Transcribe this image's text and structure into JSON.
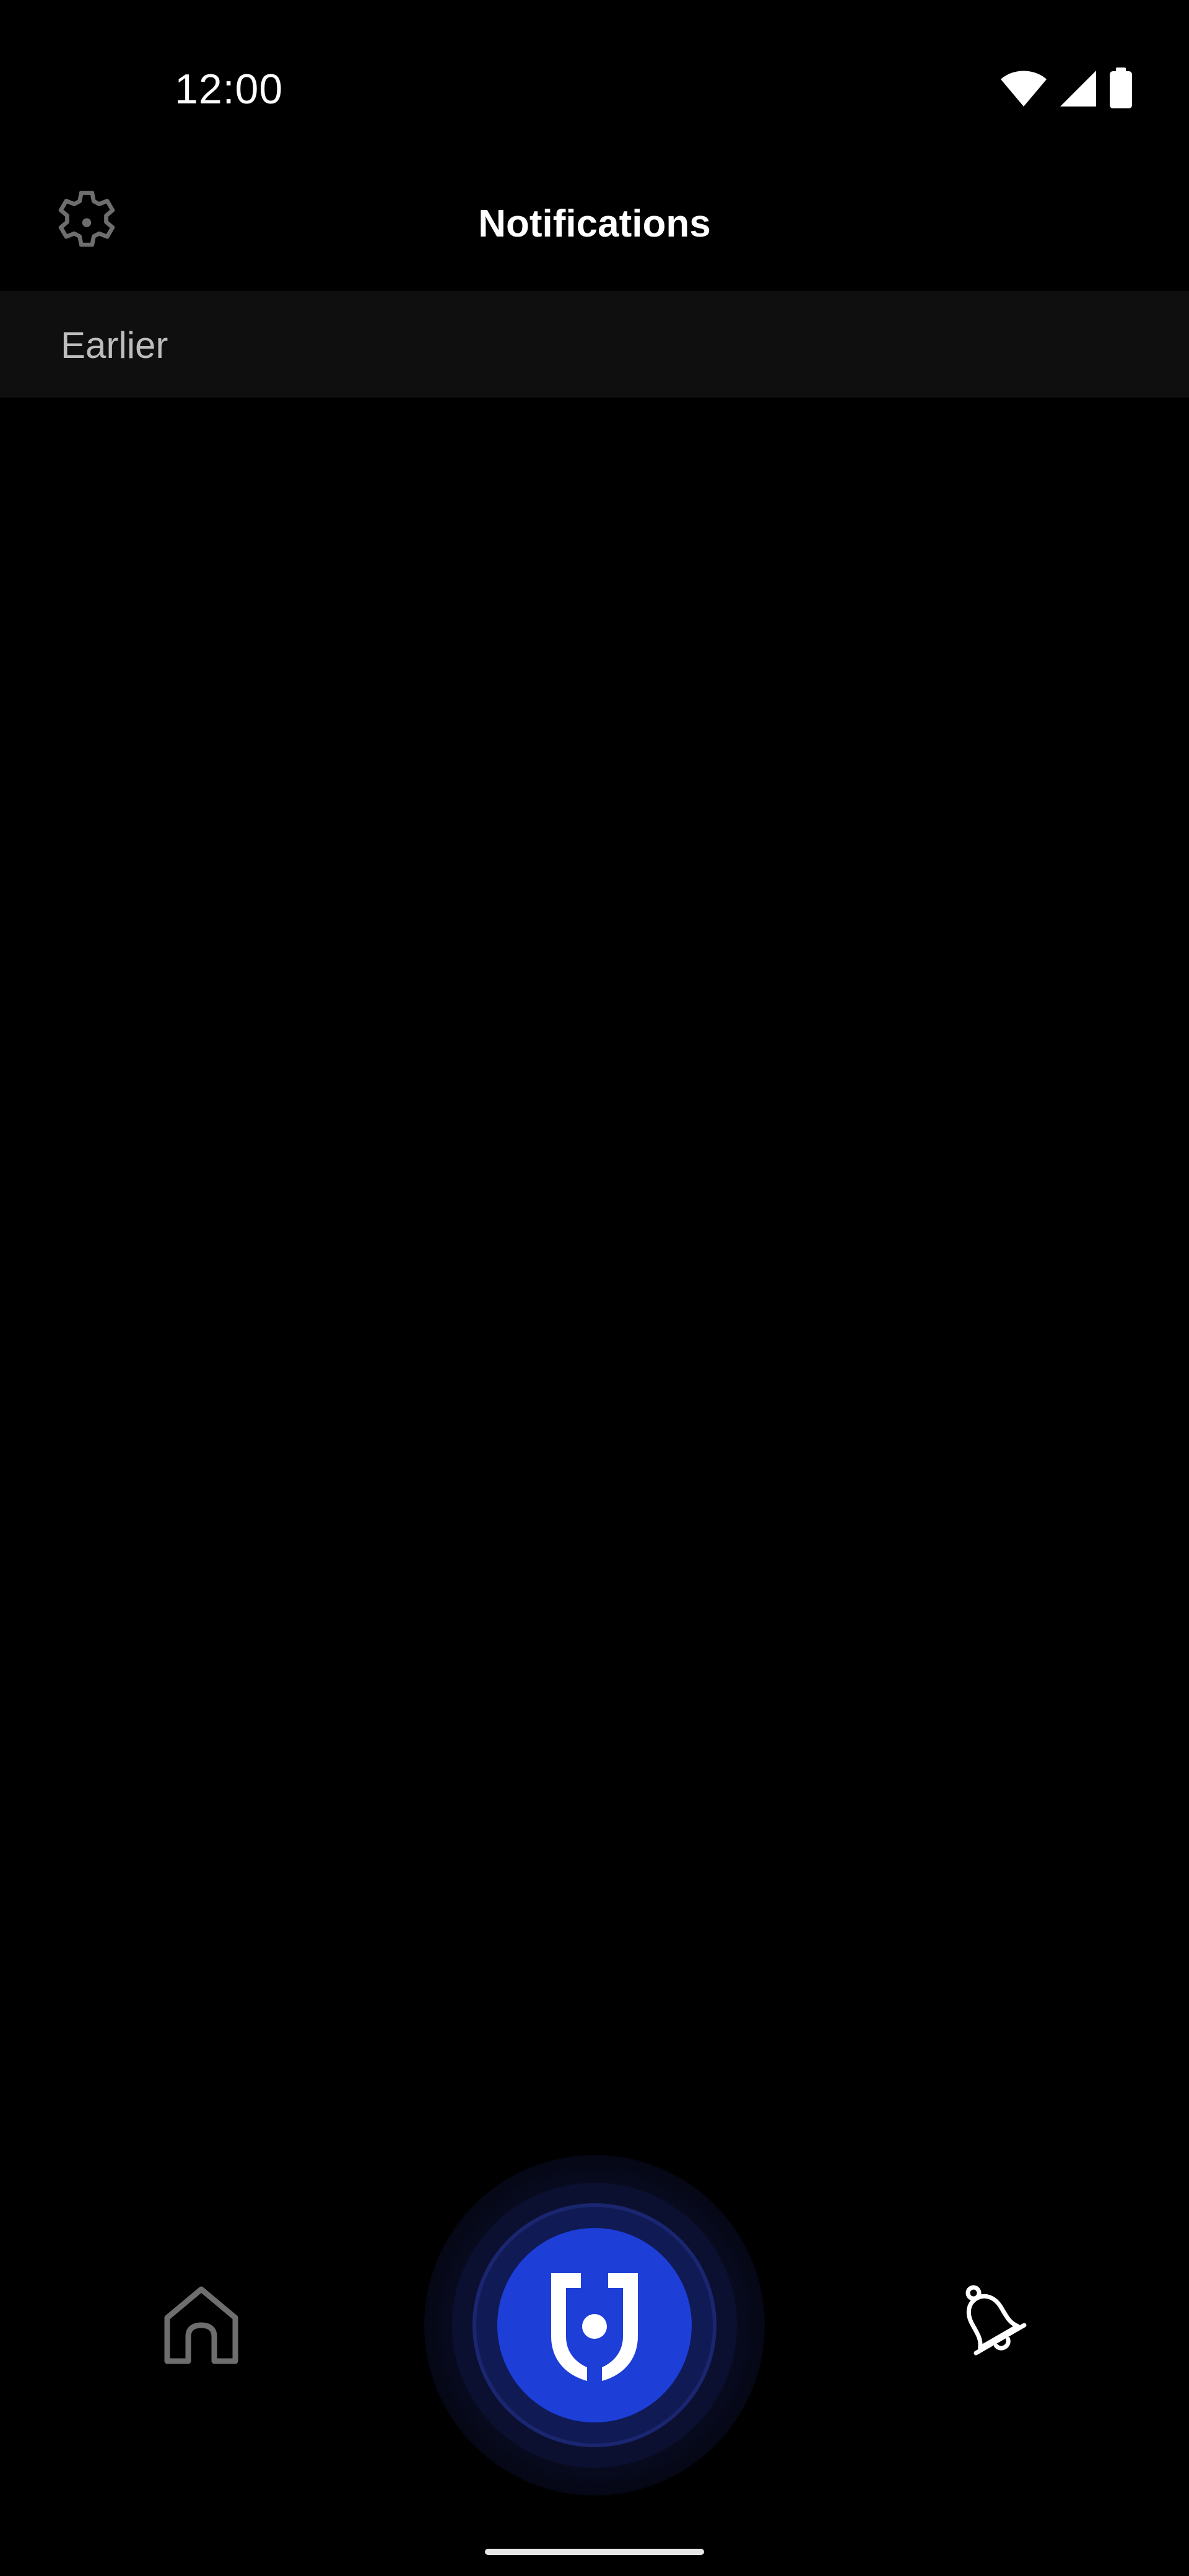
{
  "status_bar": {
    "time": "12:00",
    "icons": [
      "wifi-icon",
      "cellular-signal-icon",
      "battery-icon"
    ]
  },
  "header": {
    "title": "Notifications",
    "settings_icon": "gear-icon"
  },
  "sections": [
    {
      "label": "Earlier",
      "items": []
    }
  ],
  "bottom_nav": {
    "items": [
      {
        "icon": "home-icon",
        "active": false
      },
      {
        "icon": "shield-icon",
        "active": false
      },
      {
        "icon": "bell-icon",
        "active": true
      }
    ]
  },
  "colors": {
    "background": "#000000",
    "section_header_bg": "#0f0f10",
    "accent_blue": "#1e3ed8",
    "inactive_icon": "#6e6e6e",
    "active_icon": "#ffffff"
  }
}
